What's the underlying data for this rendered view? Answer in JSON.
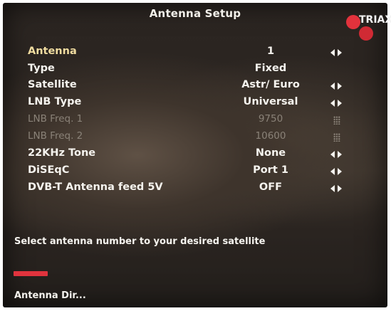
{
  "header": {
    "title": "Antenna Setup",
    "logo_text": "TRIAX"
  },
  "settings": [
    {
      "label": "Antenna",
      "value": "1",
      "control": "arrows",
      "state": "selected"
    },
    {
      "label": "Type",
      "value": "Fixed",
      "control": "none",
      "state": "normal"
    },
    {
      "label": "Satellite",
      "value": "Astr/ Euro",
      "control": "arrows",
      "state": "normal"
    },
    {
      "label": "LNB Type",
      "value": "Universal",
      "control": "arrows",
      "state": "normal"
    },
    {
      "label": "LNB Freq. 1",
      "value": "9750",
      "control": "keypad",
      "state": "disabled"
    },
    {
      "label": "LNB Freq. 2",
      "value": "10600",
      "control": "keypad",
      "state": "disabled"
    },
    {
      "label": "22KHz Tone",
      "value": "None",
      "control": "arrows",
      "state": "normal"
    },
    {
      "label": "DiSEqC",
      "value": "Port 1",
      "control": "arrows",
      "state": "normal"
    },
    {
      "label": "DVB-T Antenna feed 5V",
      "value": "OFF",
      "control": "arrows",
      "state": "normal"
    }
  ],
  "help_text": "Select antenna number to your desired satellite",
  "footer": {
    "red_button_color": "#e0333d",
    "red_button_label": "Antenna Dir..."
  },
  "colors": {
    "selected_label": "#f0dca0",
    "text": "#f5f3ee",
    "disabled_text": "#8a8278",
    "logo_red": "#e2323c"
  }
}
